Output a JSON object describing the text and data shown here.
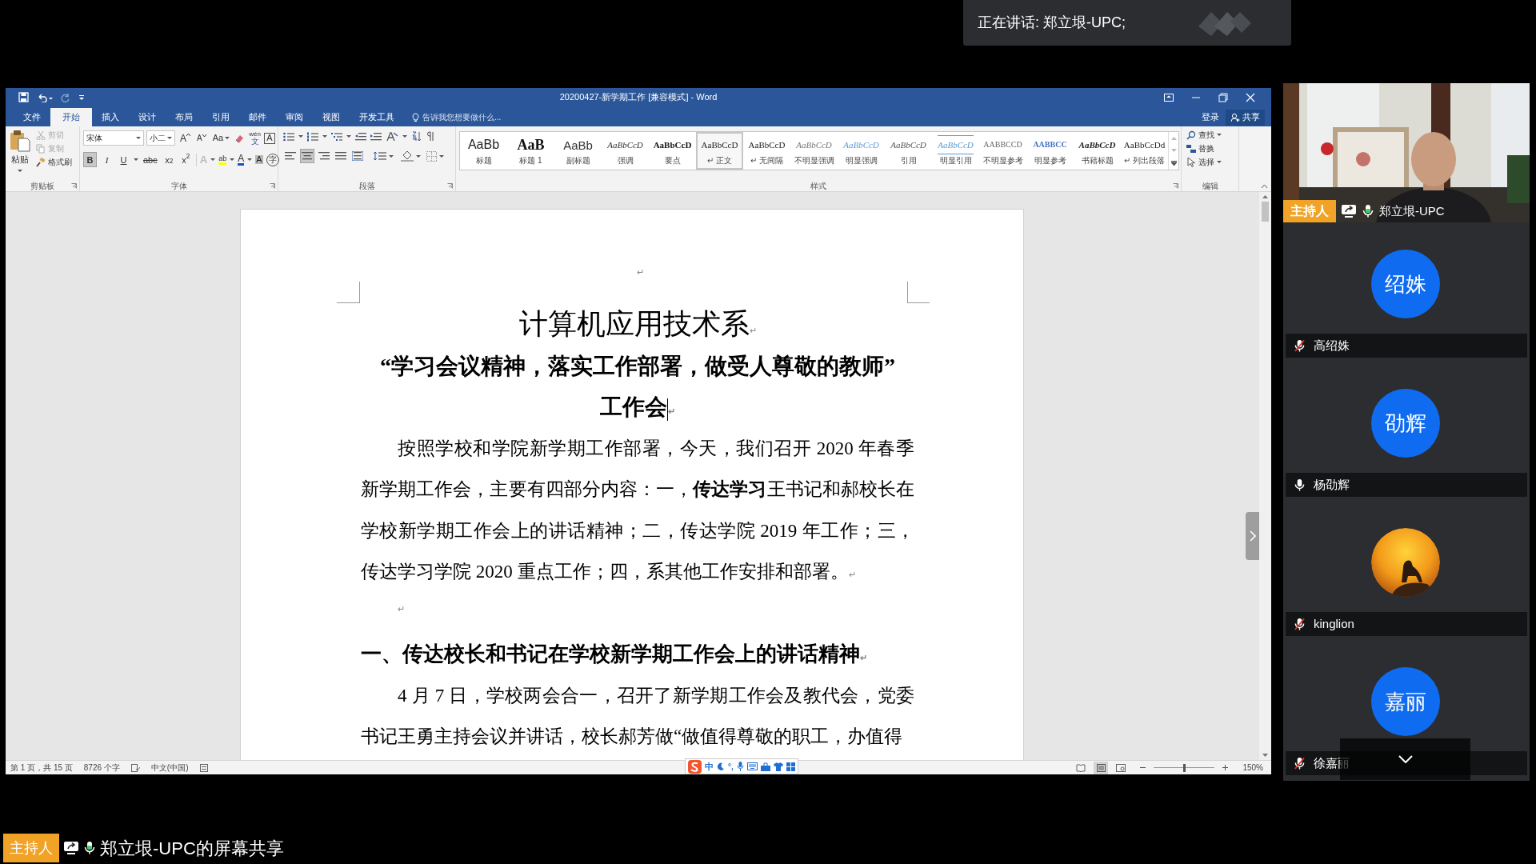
{
  "speaking_banner": {
    "text": "正在讲话: 郑立垠-UPC;"
  },
  "word": {
    "title": "20200427-新学期工作 [兼容模式] - Word",
    "tabs": [
      {
        "label": "文件",
        "selected": false
      },
      {
        "label": "开始",
        "selected": true
      },
      {
        "label": "插入",
        "selected": false
      },
      {
        "label": "设计",
        "selected": false
      },
      {
        "label": "布局",
        "selected": false
      },
      {
        "label": "引用",
        "selected": false
      },
      {
        "label": "邮件",
        "selected": false
      },
      {
        "label": "审阅",
        "selected": false
      },
      {
        "label": "视图",
        "selected": false
      },
      {
        "label": "开发工具",
        "selected": false
      }
    ],
    "tell_me": "告诉我您想要做什么...",
    "sign_in": "登录",
    "share": "共享",
    "clipboard": {
      "label": "剪贴板",
      "paste": "粘贴",
      "tools": [
        {
          "kind": "cut",
          "label": "剪切",
          "disabled": true
        },
        {
          "kind": "copy",
          "label": "复制",
          "disabled": true
        },
        {
          "kind": "painter",
          "label": "格式刷",
          "disabled": false
        }
      ]
    },
    "font": {
      "label": "字体",
      "name": "宋体",
      "size": "小二",
      "grow": "A",
      "shrink": "A",
      "case": "Aa",
      "pinyin_top": "wén",
      "pinyin_bottom": "文",
      "border": "A",
      "format": [
        {
          "kind": "bold",
          "label": "B",
          "selected": true
        },
        {
          "kind": "italic",
          "label": "I",
          "selected": false
        },
        {
          "kind": "underline",
          "label": "U",
          "selected": false
        },
        {
          "kind": "strike",
          "label": "abc",
          "selected": false
        },
        {
          "kind": "sub",
          "label": "x$_{2}$",
          "selected": false
        },
        {
          "kind": "sup",
          "label": "x$^{2}$",
          "selected": false
        }
      ],
      "effects": [
        {
          "kind": "effects",
          "label": "A"
        },
        {
          "kind": "highlight",
          "label": "ab"
        },
        {
          "kind": "color",
          "label": "A"
        },
        {
          "kind": "shading",
          "label": "A"
        },
        {
          "kind": "enclose",
          "label": "字"
        }
      ]
    },
    "paragraph": {
      "label": "段落",
      "align": [
        {
          "kind": "left",
          "selected": false
        },
        {
          "kind": "center",
          "selected": true
        },
        {
          "kind": "right",
          "selected": false
        },
        {
          "kind": "justify",
          "selected": false
        },
        {
          "kind": "distributed",
          "selected": false
        }
      ]
    },
    "styles": {
      "label": "样式",
      "items": [
        {
          "kind": "title",
          "preview": "AaBb",
          "label": "标题",
          "selected": false
        },
        {
          "kind": "heading",
          "preview": "AaB",
          "label": "标题 1",
          "selected": false
        },
        {
          "kind": "subtitle",
          "preview": "AaBb",
          "label": "副标题",
          "selected": false
        },
        {
          "kind": "emphasis",
          "preview": "AaBbCcD",
          "label": "强调",
          "selected": false
        },
        {
          "kind": "strong",
          "preview": "AaBbCcD",
          "label": "要点",
          "selected": false
        },
        {
          "kind": "normal",
          "preview": "AaBbCcD",
          "label": "↵ 正文",
          "selected": true
        },
        {
          "kind": "normal",
          "preview": "AaBbCcD",
          "label": "↵ 无间隔",
          "selected": false
        },
        {
          "kind": "subtle",
          "preview": "AaBbCcD",
          "label": "不明显强调",
          "selected": false
        },
        {
          "kind": "intense",
          "preview": "AaBbCcD",
          "label": "明显强调",
          "selected": false
        },
        {
          "kind": "quote",
          "preview": "AaBbCcD",
          "label": "引用",
          "selected": false
        },
        {
          "kind": "intense_quote",
          "preview": "AaBbCcD",
          "label": "明显引用",
          "selected": false
        },
        {
          "kind": "reference",
          "preview": "AABBCCD",
          "label": "不明显参考",
          "selected": false
        },
        {
          "kind": "intense_reference",
          "preview": "AABBCC",
          "label": "明显参考",
          "selected": false
        },
        {
          "kind": "book",
          "preview": "AaBbCcD",
          "label": "书籍标题",
          "selected": false
        },
        {
          "kind": "normal",
          "preview": "AaBbCcDd",
          "label": "↵ 列出段落",
          "selected": false
        }
      ]
    },
    "editing": {
      "label": "编辑",
      "items": [
        {
          "kind": "find",
          "label": "查找"
        },
        {
          "kind": "replace",
          "label": "替换"
        },
        {
          "kind": "select",
          "label": "选择"
        }
      ]
    },
    "document": [
      {
        "kind": "empty_center",
        "mark": "↵"
      },
      {
        "kind": "title",
        "lines": [
          "计算机应用技术系"
        ],
        "mark": "↵"
      },
      {
        "kind": "subtitle",
        "lines": [
          "“学习会议精神，落实工作部署，做受人尊敬的教师”",
          "工作会"
        ],
        "mark": "↵"
      },
      {
        "kind": "body",
        "lines": [
          "按照学校和学院新学期工作部署，今天，我们召开 2020 年春季",
          "新学期工作会，主要有四部分内容：一，**传达学习**王书记和郝校长在",
          "学校新学期工作会上的讲话精神；二，传达学院 2019 年工作；三，",
          "传达学习学院 2020 重点工作；四，系其他工作安排和部署。"
        ],
        "mark": "↵"
      },
      {
        "kind": "empty",
        "mark": "↵"
      },
      {
        "kind": "heading",
        "lines": [
          "一、传达校长和书记在学校新学期工作会上的讲话精神"
        ],
        "mark": "↵"
      },
      {
        "kind": "body",
        "lines": [
          "4 月 7 日，学校两会合一，召开了新学期工作会及教代会，党委",
          "书记王勇主持会议并讲话，校长郝芳做“做值得尊敬的职工，办值得"
        ]
      }
    ],
    "status": {
      "page": "第 1 页，共 15 页",
      "words": "8726 个字",
      "language": "中文(中国)",
      "ime_mode": "中",
      "ime_punct": "°,",
      "zoom": "150%",
      "zoom_slider": {
        "level": 0.5
      }
    }
  },
  "host": {
    "badge": "主持人",
    "name": "郑立垠-UPC",
    "mic_active": true
  },
  "participants": [
    {
      "name": "高绍姝",
      "mic_muted": true,
      "avatar": {
        "kind": "initials",
        "text": "绍姝"
      }
    },
    {
      "name": "杨劭辉",
      "mic_muted": false,
      "avatar": {
        "kind": "initials",
        "text": "劭辉"
      }
    },
    {
      "name": "kinglion",
      "mic_muted": true
    },
    {
      "name": "徐嘉丽",
      "mic_muted": true,
      "avatar": {
        "kind": "initials",
        "text": "嘉丽"
      }
    }
  ],
  "screen_share_bar": {
    "badge": "主持人",
    "mic_active": true,
    "text": "郑立垠-UPC的屏幕共享"
  }
}
